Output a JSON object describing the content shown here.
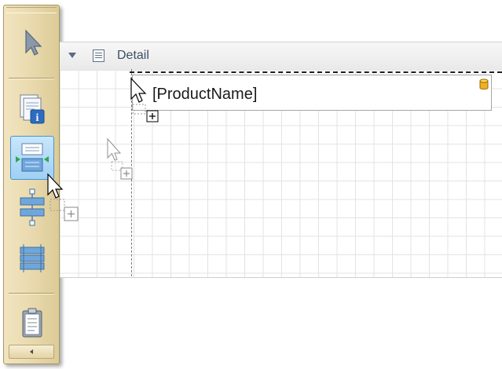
{
  "toolbox": {
    "tools": [
      {
        "name": "Pointer",
        "icon": "pointer-arrow-icon",
        "active": false
      },
      {
        "name": "Report Info",
        "icon": "report-info-icon",
        "active": false
      },
      {
        "name": "Insert Detail Band",
        "icon": "insert-band-icon",
        "active": true
      },
      {
        "name": "Insert Band Splitter",
        "icon": "band-splitter-icon",
        "active": false
      },
      {
        "name": "Insert Multiple Bands",
        "icon": "multi-band-icon",
        "active": false
      },
      {
        "name": "Report Explorer",
        "icon": "clipboard-icon",
        "active": false
      }
    ],
    "scroll_icon": "scroll-left-icon"
  },
  "band": {
    "title": "Detail",
    "expand_icon": "collapse-triangle-icon",
    "band_icon": "detail-band-icon"
  },
  "control": {
    "label": "[ProductName]",
    "icon": "database-field-icon"
  },
  "cursors": [
    "drag-copy-cursor",
    "drag-copy-cursor",
    "drag-copy-cursor"
  ],
  "colors": {
    "toolbox_bg": "#eadbb0",
    "active_tool": "#9fd0f4",
    "band_title": "#3c4f66",
    "grid_line": "#e3e3e3"
  }
}
